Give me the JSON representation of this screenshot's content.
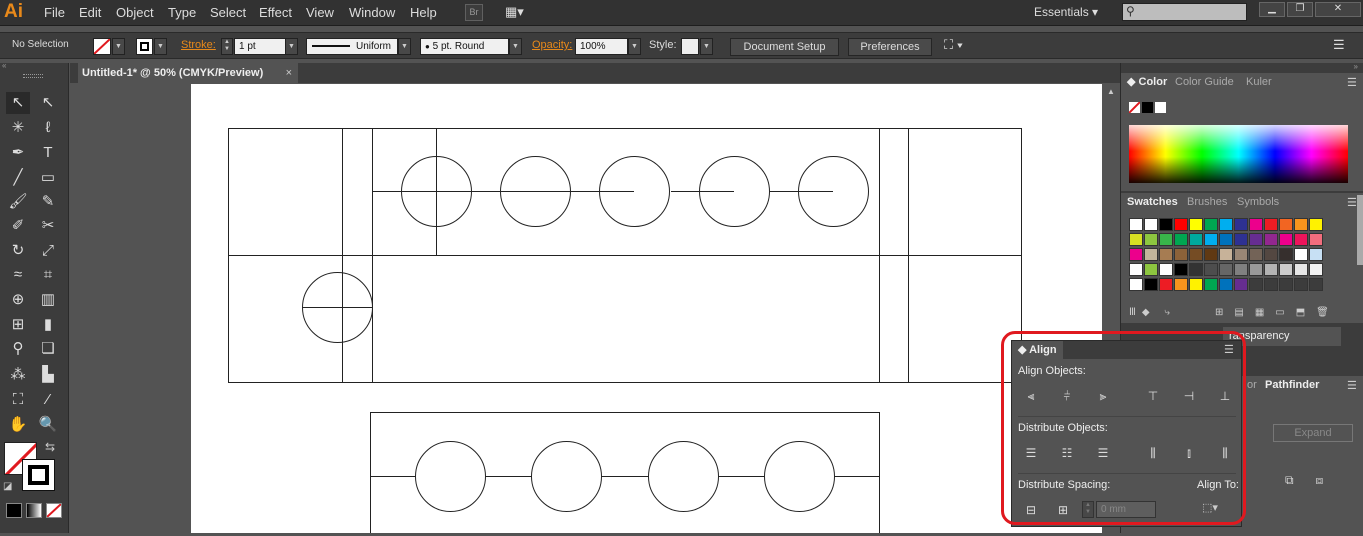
{
  "app": {
    "logo": "Ai"
  },
  "menu": [
    "File",
    "Edit",
    "Object",
    "Type",
    "Select",
    "Effect",
    "View",
    "Window",
    "Help"
  ],
  "menubar": {
    "bridge": "Br",
    "workspace": "Essentials",
    "search_placeholder": ""
  },
  "control": {
    "selection": "No Selection",
    "stroke_label": "Stroke:",
    "stroke_weight": "1 pt",
    "profile": "Uniform",
    "brush": "5 pt. Round",
    "opacity_label": "Opacity:",
    "opacity": "100%",
    "style_label": "Style:",
    "document_setup": "Document Setup",
    "preferences": "Preferences"
  },
  "document": {
    "tab": "Untitled-1* @ 50% (CMYK/Preview)",
    "close": "×"
  },
  "tools": [
    "selection-tool",
    "direct-selection-tool",
    "magic-wand-tool",
    "lasso-tool",
    "pen-tool",
    "type-tool",
    "line-tool",
    "rectangle-tool",
    "paintbrush-tool",
    "pencil-tool",
    "blob-brush-tool",
    "scissors-tool",
    "rotate-tool",
    "scale-tool",
    "width-tool",
    "free-transform-tool",
    "shape-builder-tool",
    "perspective-grid-tool",
    "mesh-tool",
    "gradient-tool",
    "eyedropper-tool",
    "blend-tool",
    "symbol-sprayer-tool",
    "column-graph-tool",
    "artboard-tool",
    "slice-tool",
    "hand-tool",
    "zoom-tool"
  ],
  "panels": {
    "color_tabs": [
      "Color",
      "Color Guide",
      "Kuler"
    ],
    "swatch_tabs": [
      "Swatches",
      "Brushes",
      "Symbols"
    ],
    "transparency": "ransparency",
    "pathfinder_tabs": [
      "or",
      "Pathfinder"
    ],
    "expand": "Expand"
  },
  "align": {
    "title": "Align",
    "align_objects": "Align Objects:",
    "distribute_objects": "Distribute Objects:",
    "distribute_spacing": "Distribute Spacing:",
    "align_to": "Align To:",
    "spacing_value": "0 mm"
  },
  "colors": {
    "accent": "#e8891a",
    "highlight": "#e0191f"
  },
  "swatch_rows": [
    [
      "#ffffff",
      "#ffffff",
      "#000000",
      "#ff0000",
      "#ffff00",
      "#00a651",
      "#00aeef",
      "#2e3192",
      "#ec008c",
      "#ed1c24",
      "#f26522",
      "#f7941d",
      "#fff200"
    ],
    [
      "#d7df23",
      "#8dc63f",
      "#39b54a",
      "#00a651",
      "#00a99d",
      "#00aeef",
      "#0072bc",
      "#2e3192",
      "#662d91",
      "#92278f",
      "#ec008c",
      "#ed145b",
      "#f26d7d"
    ],
    [
      "#ec008c",
      "#c2b59b",
      "#a67c52",
      "#8c6239",
      "#754c24",
      "#603913",
      "#c7b299",
      "#998675",
      "#736357",
      "#534741",
      "#362f2d",
      "#ffffff",
      "#c7e0f4"
    ],
    [
      "#ffffff",
      "#8dc63f",
      "#ffffff",
      "#000000",
      "#333333",
      "#4d4d4d",
      "#666666",
      "#808080",
      "#999999",
      "#b3b3b3",
      "#cccccc",
      "#e6e6e6",
      "#f2f2f2"
    ],
    [
      "#ffffff",
      "#000000",
      "#ed1c24",
      "#f7941d",
      "#fff200",
      "#00a651",
      "#0072bc",
      "#662d91",
      "#3c3c3c",
      "#3c3c3c",
      "#3c3c3c",
      "#3c3c3c",
      "#3c3c3c"
    ]
  ]
}
